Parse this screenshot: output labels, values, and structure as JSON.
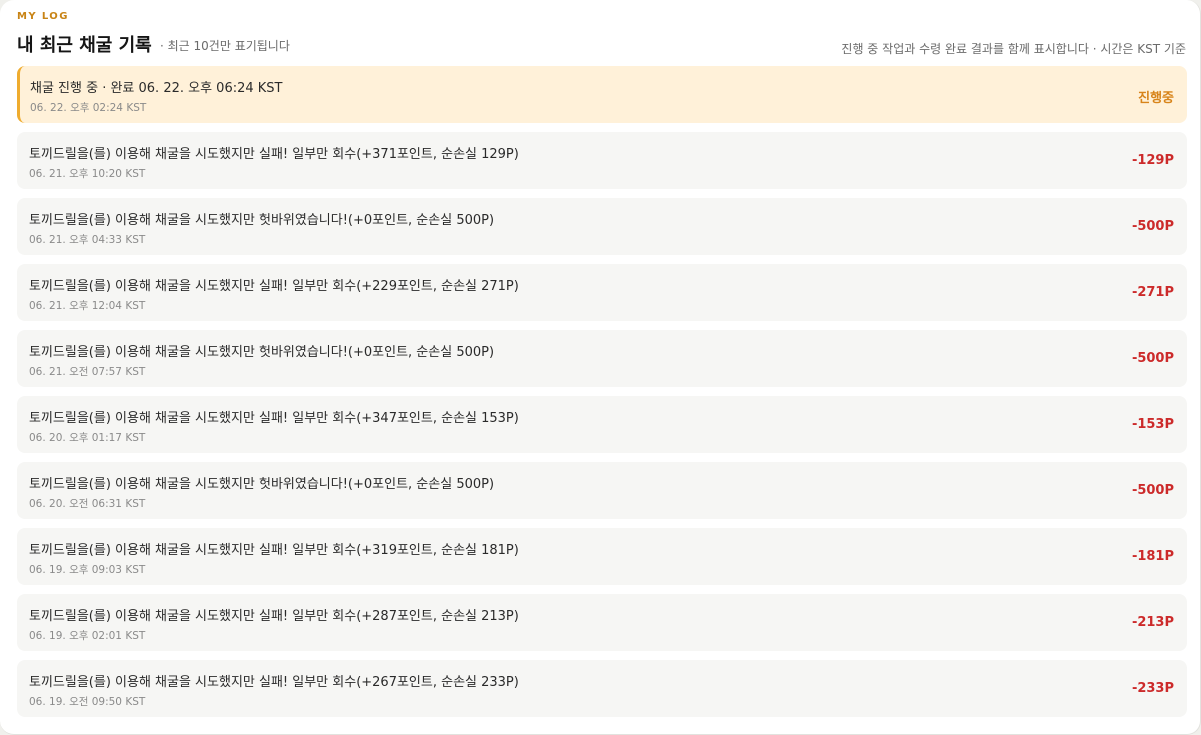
{
  "header": {
    "eyebrow": "MY LOG",
    "title": "내 최근 채굴 기록",
    "subtitle": "· 최근 10건만 표기됩니다",
    "note": "진행 중 작업과 수령 완료 결과를 함께 표시합니다 · 시간은 KST 기준"
  },
  "colors": {
    "accent": "#c88416",
    "active_bg": "#fff1d9",
    "active_border": "#efac2f",
    "loss": "#cc2a2a",
    "in_progress": "#d8841a"
  },
  "logs": [
    {
      "message": "채굴 진행 중 · 완료 06. 22. 오후 06:24 KST",
      "time": "06. 22. 오후 02:24 KST",
      "amount": "진행중",
      "status": "in_progress"
    },
    {
      "message": "토끼드릴을(를) 이용해 채굴을 시도했지만 실패! 일부만 회수(+371포인트, 순손실 129P)",
      "time": "06. 21. 오후 10:20 KST",
      "amount": "-129P",
      "status": "loss"
    },
    {
      "message": "토끼드릴을(를) 이용해 채굴을 시도했지만 헛바위였습니다!(+0포인트, 순손실 500P)",
      "time": "06. 21. 오후 04:33 KST",
      "amount": "-500P",
      "status": "loss"
    },
    {
      "message": "토끼드릴을(를) 이용해 채굴을 시도했지만 실패! 일부만 회수(+229포인트, 순손실 271P)",
      "time": "06. 21. 오후 12:04 KST",
      "amount": "-271P",
      "status": "loss"
    },
    {
      "message": "토끼드릴을(를) 이용해 채굴을 시도했지만 헛바위였습니다!(+0포인트, 순손실 500P)",
      "time": "06. 21. 오전 07:57 KST",
      "amount": "-500P",
      "status": "loss"
    },
    {
      "message": "토끼드릴을(를) 이용해 채굴을 시도했지만 실패! 일부만 회수(+347포인트, 순손실 153P)",
      "time": "06. 20. 오후 01:17 KST",
      "amount": "-153P",
      "status": "loss"
    },
    {
      "message": "토끼드릴을(를) 이용해 채굴을 시도했지만 헛바위였습니다!(+0포인트, 순손실 500P)",
      "time": "06. 20. 오전 06:31 KST",
      "amount": "-500P",
      "status": "loss"
    },
    {
      "message": "토끼드릴을(를) 이용해 채굴을 시도했지만 실패! 일부만 회수(+319포인트, 순손실 181P)",
      "time": "06. 19. 오후 09:03 KST",
      "amount": "-181P",
      "status": "loss"
    },
    {
      "message": "토끼드릴을(를) 이용해 채굴을 시도했지만 실패! 일부만 회수(+287포인트, 순손실 213P)",
      "time": "06. 19. 오후 02:01 KST",
      "amount": "-213P",
      "status": "loss"
    },
    {
      "message": "토끼드릴을(를) 이용해 채굴을 시도했지만 실패! 일부만 회수(+267포인트, 순손실 233P)",
      "time": "06. 19. 오전 09:50 KST",
      "amount": "-233P",
      "status": "loss"
    }
  ]
}
